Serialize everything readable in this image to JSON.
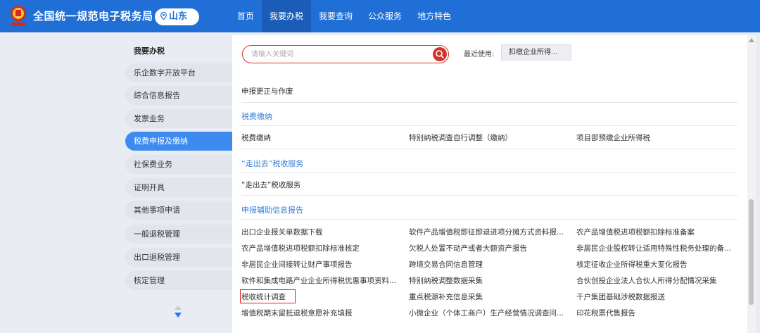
{
  "header": {
    "brand": "全国统一规范电子税务局",
    "region": "山东",
    "nav": [
      "首页",
      "我要办税",
      "我要查询",
      "公众服务",
      "地方特色"
    ],
    "active_nav": "我要办税",
    "colors": {
      "header_bg": "#1f6fd6",
      "active_bg": "#1a5cb8"
    }
  },
  "sidebar": {
    "title": "我要办税",
    "items": [
      "乐企数字开放平台",
      "综合信息报告",
      "发票业务",
      "税费申报及缴纳",
      "社保费业务",
      "证明开具",
      "其他事项申请",
      "一般退税管理",
      "出口退税管理",
      "核定管理"
    ],
    "active": "税费申报及缴纳"
  },
  "search": {
    "placeholder": "请输入关键词",
    "recent_label": "最近使用:",
    "recent_item": "扣缴企业所得..."
  },
  "sections": {
    "s0": {
      "items": [
        "申报更正与作废"
      ]
    },
    "s1": {
      "title": "税费缴纳",
      "items": [
        "税费缴纳",
        "特别纳税调查自行调整（缴纳）",
        "项目部预缴企业所得税"
      ]
    },
    "s2": {
      "title": "“走出去”税收服务",
      "items": [
        "“走出去”税收服务"
      ]
    },
    "s3": {
      "title": "申报辅助信息报告",
      "items": [
        "出口企业报关单数据下载",
        "软件产品增值税即征即退进项分摊方式资料报...",
        "农产品增值税进项税额扣除标准备案",
        "农产品增值税进项税额扣除标准核定",
        "欠税人处置不动产或者大额资产报告",
        "非居民企业股权转让适用特殊性税务处理的备...",
        "非居民企业间接转让财产事项报告",
        "跨境交易合同信息管理",
        "核定征收企业所得税重大变化报告",
        "软件和集成电路产业企业所得税优惠事项资料...",
        "特别纳税调整数据采集",
        "合伙创投企业法人合伙人所得分配情况采集",
        "税收统计调查",
        "重点税源补充信息采集",
        "千户集团基础涉税数据报送",
        "增值税期末留抵退税意愿补充填报",
        "小微企业（个体工商户）生产经营情况调查问...",
        "印花税票代售报告"
      ]
    }
  },
  "highlighted_item": "税收统计调查"
}
